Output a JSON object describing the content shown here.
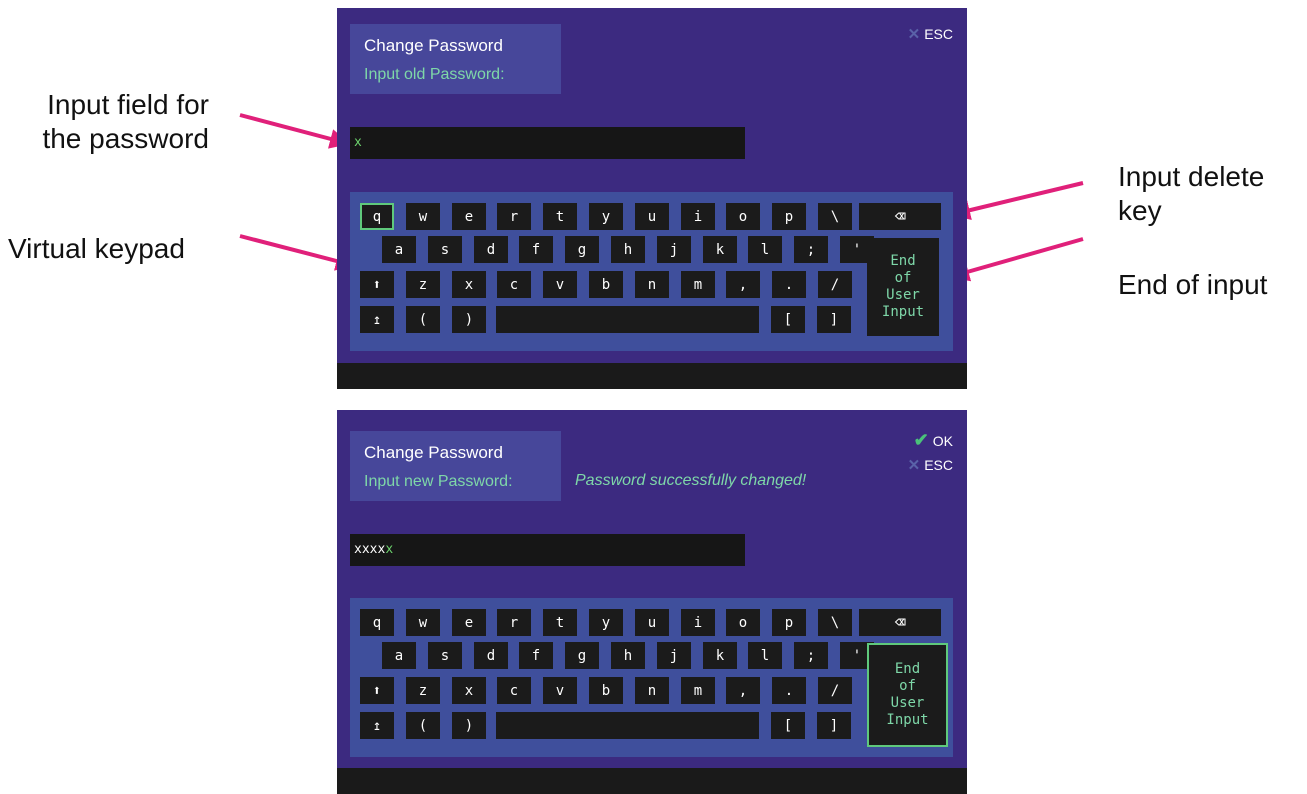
{
  "annotations": {
    "input_field": "Input field for\nthe password",
    "virtual_keypad": "Virtual keypad",
    "delete_key": "Input delete\nkey",
    "end_of_input": "End of input"
  },
  "screens": [
    {
      "title": "Change Password",
      "prompt": "Input old Password:",
      "esc_label": "ESC",
      "input_value": "",
      "input_cursor": "x",
      "selected_key": "q"
    },
    {
      "title": "Change Password",
      "prompt": "Input new Password:",
      "message": "Password successfully changed!",
      "ok_label": "OK",
      "esc_label": "ESC",
      "input_value": "xxxx",
      "input_cursor": "x",
      "selected_key": "end"
    }
  ],
  "keypad": {
    "row1": [
      "q",
      "w",
      "e",
      "r",
      "t",
      "y",
      "u",
      "i",
      "o",
      "p",
      "\\"
    ],
    "row2": [
      "a",
      "s",
      "d",
      "f",
      "g",
      "h",
      "j",
      "k",
      "l",
      ";",
      "'"
    ],
    "row3": [
      "⬆",
      "z",
      "x",
      "c",
      "v",
      "b",
      "n",
      "m",
      ",",
      ".",
      "/"
    ],
    "row4_left": [
      "↥",
      "(",
      ")"
    ],
    "row4_right": [
      "[",
      "]"
    ],
    "delete_symbol": "⌫",
    "end_label": "End\nof\nUser\nInput"
  },
  "colors": {
    "panel_bg": "#3c2a80",
    "keypad_bg": "#3f4f9c",
    "key_bg": "#1b1b1b",
    "accent_green": "#7ed7a8",
    "select_border": "#5fc97c",
    "arrow": "#e0207a"
  }
}
